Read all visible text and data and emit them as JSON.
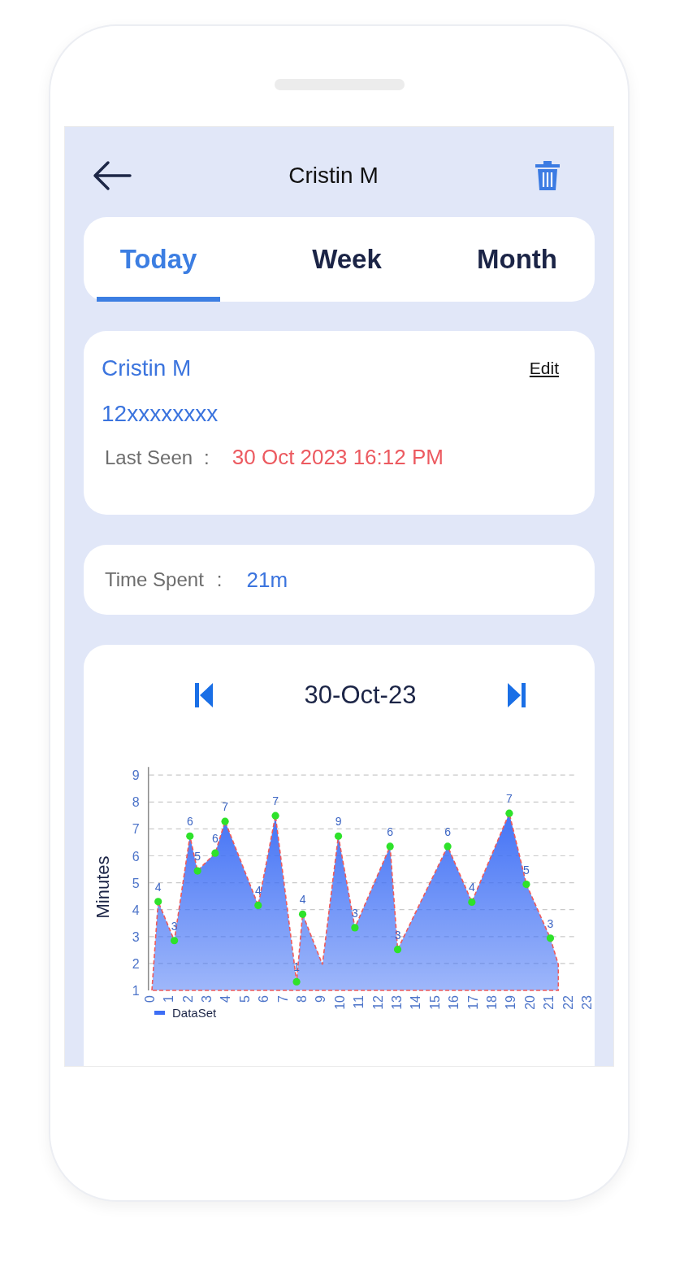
{
  "header": {
    "title": "Cristin M"
  },
  "tabs": [
    {
      "label": "Today",
      "selected": true
    },
    {
      "label": "Week",
      "selected": false
    },
    {
      "label": "Month",
      "selected": false
    }
  ],
  "profile": {
    "name": "Cristin M",
    "edit_link": "Edit",
    "phone": "12xxxxxxxx",
    "last_seen_label": "Last Seen",
    "separator": ":",
    "last_seen_value": "30 Oct 2023 16:12 PM"
  },
  "time_spent": {
    "label": "Time Spent",
    "separator": ":",
    "value": "21m"
  },
  "chart_card": {
    "date": "30-Oct-23",
    "chart_data": {
      "type": "area",
      "ylabel": "Minutes",
      "x": [
        0.14,
        0.47,
        1.32,
        2.14,
        2.54,
        3.47,
        3.99,
        5.73,
        6.64,
        7.75,
        8.07,
        9.11,
        9.95,
        10.82,
        12.67,
        13.07,
        15.7,
        16.97,
        18.94,
        19.84,
        21.1,
        21.52
      ],
      "grid": true,
      "series": [
        {
          "name": "DataSet",
          "color": "#3d6ef5",
          "values": [
            1,
            4.3,
            2.85,
            6.73,
            5.44,
            6.1,
            7.28,
            4.16,
            7.49,
            1.32,
            3.83,
            1.96,
            6.73,
            3.33,
            6.35,
            2.52,
            6.35,
            4.28,
            7.58,
            4.94,
            2.94,
            1.96
          ]
        }
      ],
      "value_labels": [
        null,
        "4",
        "3",
        "6",
        "5",
        "6",
        "7",
        "4",
        "7",
        "1",
        "4",
        null,
        "9",
        "3",
        "6",
        "3",
        "6",
        "4",
        "7",
        "5",
        "3",
        null
      ],
      "xlim": [
        0,
        23
      ],
      "ylim": [
        1,
        9
      ],
      "xticks": [
        0,
        1,
        2,
        3,
        4,
        5,
        6,
        7,
        8,
        9,
        10,
        11,
        12,
        13,
        14,
        15,
        16,
        17,
        18,
        19,
        20,
        21,
        22,
        23
      ],
      "yticks": [
        1,
        2,
        3,
        4,
        5,
        6,
        7,
        8,
        9
      ]
    }
  }
}
